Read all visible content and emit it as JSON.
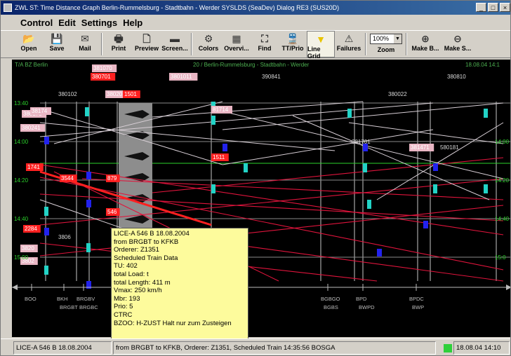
{
  "window": {
    "title": "ZWL ST: Time Distance Graph Berlin-Rummelsburg - Stadtbahn - Werder SYSLDS (SeaDev) Dialog RE3 (SUS20D)"
  },
  "menu": [
    "Control",
    "Edit",
    "Settings",
    "Help"
  ],
  "toolbar": [
    {
      "label": "Open",
      "icon": "folder-open-icon",
      "glyph": "📂"
    },
    {
      "label": "Save",
      "icon": "floppy-disk-icon",
      "glyph": "💾"
    },
    {
      "label": "Mail",
      "icon": "mail-icon",
      "glyph": "✉"
    },
    {
      "label": "Print",
      "icon": "printer-icon",
      "glyph": "🖶"
    },
    {
      "label": "Preview",
      "icon": "print-preview-icon",
      "glyph": "🗋"
    },
    {
      "label": "Screen...",
      "icon": "screen-icon",
      "glyph": "▬"
    },
    {
      "label": "Colors",
      "icon": "colors-icon",
      "glyph": "⚙"
    },
    {
      "label": "Overvi...",
      "icon": "overview-icon",
      "glyph": "▦"
    },
    {
      "label": "Find",
      "icon": "binoculars-icon",
      "glyph": "⛶"
    },
    {
      "label": "TT/Prio",
      "icon": "train-icon",
      "glyph": "🚆"
    },
    {
      "label": "Line Grid",
      "icon": "line-grid-icon",
      "glyph": "▼"
    },
    {
      "label": "Failures",
      "icon": "warning-icon",
      "glyph": "⚠"
    }
  ],
  "zoom": {
    "label": "Zoom",
    "value": "100%"
  },
  "toolbar_right": [
    {
      "label": "Make B...",
      "icon": "zoom-in-icon",
      "glyph": "⊕"
    },
    {
      "label": "Make S...",
      "icon": "zoom-out-icon",
      "glyph": "⊖"
    }
  ],
  "graph": {
    "header_left": "T/A BZ Berlin",
    "header_center": "20 / Berlin-Rummelsburg - Stadtbahn - Werder",
    "header_right": "18.08.04 14:1",
    "time_labels": [
      "13:40",
      "14:00",
      "14:20",
      "14:40",
      "15:00"
    ],
    "time_labels_right": [
      "14:00",
      "14:20",
      "14:40",
      "15:0"
    ],
    "station_labels": [
      {
        "code": "BOO",
        "name": ""
      },
      {
        "code": "BKH",
        "name": "BRGBT"
      },
      {
        "code": "BRGBV",
        "name": "BRGBC"
      },
      {
        "code": "BWS",
        "name": ""
      },
      {
        "code": "BGBGO",
        "name": "BGBS"
      },
      {
        "code": "BPD",
        "name": "BWPD"
      },
      {
        "code": "BPDC",
        "name": "BWP"
      }
    ],
    "train_labels": [
      "381070",
      "380701",
      "3801011",
      "390841",
      "380810",
      "380102",
      "380201",
      "380022",
      "380173",
      "38174",
      "380241",
      "381701",
      "381471",
      "580181",
      "81714",
      "1511",
      "1501",
      "1741",
      "3544",
      "879",
      "546",
      "2284",
      "3820",
      "3802",
      "3806"
    ]
  },
  "tooltip": [
    "LICE-A 546 B 18.08.2004",
    "from BRGBT to KFKB",
    "Orderer: Z1351",
    "Scheduled Train Data",
    "TU: 402",
    "total Load:  t",
    "total Length: 411 m",
    "Vmax: 250 km/h",
    "Mbr: 193",
    "Prio: 5",
    "CTRC",
    "BZOO: H-ZUST Halt nur zum Zusteigen"
  ],
  "status": {
    "train": "LICE-A 546 B 18.08.2004",
    "detail": "from BRGBT to KFKB, Orderer: Z1351, Scheduled Train 14:35:56  BOSGA",
    "datetime": "18.08.04 14:10"
  },
  "colors": {
    "graph_bg": "#000000",
    "grid": "#c9c9c9",
    "train_red": "#e0143c",
    "train_pink": "#d8cfd6",
    "label_cyan": "#22d3c6",
    "label_blue": "#2222ee",
    "highlight_red": "#ff2020",
    "tooltip_bg": "#fdfb9c",
    "time_green": "#2bd42b"
  }
}
